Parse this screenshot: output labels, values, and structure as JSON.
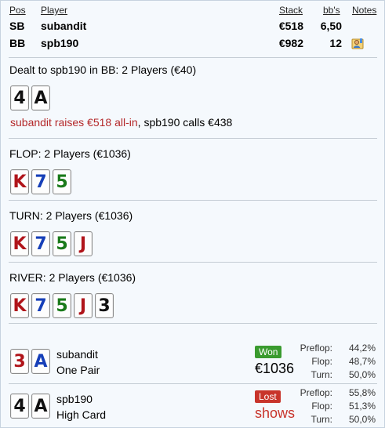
{
  "header": {
    "col_pos": "Pos",
    "col_player": "Player",
    "col_stack": "Stack",
    "col_bbs": "bb's",
    "col_notes": "Notes"
  },
  "players": [
    {
      "pos": "SB",
      "name": "subandit",
      "stack": "€518",
      "bbs": "6,50"
    },
    {
      "pos": "BB",
      "name": "spb190",
      "stack": "€982",
      "bbs": "12"
    }
  ],
  "preflop": {
    "title": "Dealt to spb190 in BB: 2 Players (€40)",
    "cards": [
      {
        "rank": "4",
        "color": "black"
      },
      {
        "rank": "A",
        "color": "black"
      }
    ],
    "action_raise": "subandit raises €518 all-in",
    "action_sep": ", ",
    "action_call": "spb190 calls €438"
  },
  "flop": {
    "title": "FLOP: 2 Players (€1036)",
    "cards": [
      {
        "rank": "K",
        "color": "red"
      },
      {
        "rank": "7",
        "color": "blue"
      },
      {
        "rank": "5",
        "color": "green"
      }
    ]
  },
  "turn": {
    "title": "TURN: 2 Players (€1036)",
    "cards": [
      {
        "rank": "K",
        "color": "red"
      },
      {
        "rank": "7",
        "color": "blue"
      },
      {
        "rank": "5",
        "color": "green"
      },
      {
        "rank": "J",
        "color": "red"
      }
    ]
  },
  "river": {
    "title": "RIVER: 2 Players (€1036)",
    "cards": [
      {
        "rank": "K",
        "color": "red"
      },
      {
        "rank": "7",
        "color": "blue"
      },
      {
        "rank": "5",
        "color": "green"
      },
      {
        "rank": "J",
        "color": "red"
      },
      {
        "rank": "3",
        "color": "black"
      }
    ]
  },
  "results": [
    {
      "cards": [
        {
          "rank": "3",
          "color": "red"
        },
        {
          "rank": "A",
          "color": "blue"
        }
      ],
      "name": "subandit",
      "hand": "One Pair",
      "badge": "Won",
      "amount": "€1036",
      "preflop_label": "Preflop:",
      "preflop": "44,2%",
      "flop_label": "Flop:",
      "flop": "48,7%",
      "turn_label": "Turn:",
      "turn": "50,0%"
    },
    {
      "cards": [
        {
          "rank": "4",
          "color": "black"
        },
        {
          "rank": "A",
          "color": "black"
        }
      ],
      "name": "spb190",
      "hand": "High Card",
      "badge": "Lost",
      "amount": "shows",
      "preflop_label": "Preflop:",
      "preflop": "55,8%",
      "flop_label": "Flop:",
      "flop": "51,3%",
      "turn_label": "Turn:",
      "turn": "50,0%"
    }
  ],
  "colors": {
    "raise_text": "#b4282a",
    "won_badge": "#3a9b2f",
    "lost_badge": "#c8342b",
    "card_red": "#b0141a",
    "card_blue": "#163fb8",
    "card_green": "#1a7a1a"
  },
  "icons": {
    "notes": "person-note-icon"
  }
}
